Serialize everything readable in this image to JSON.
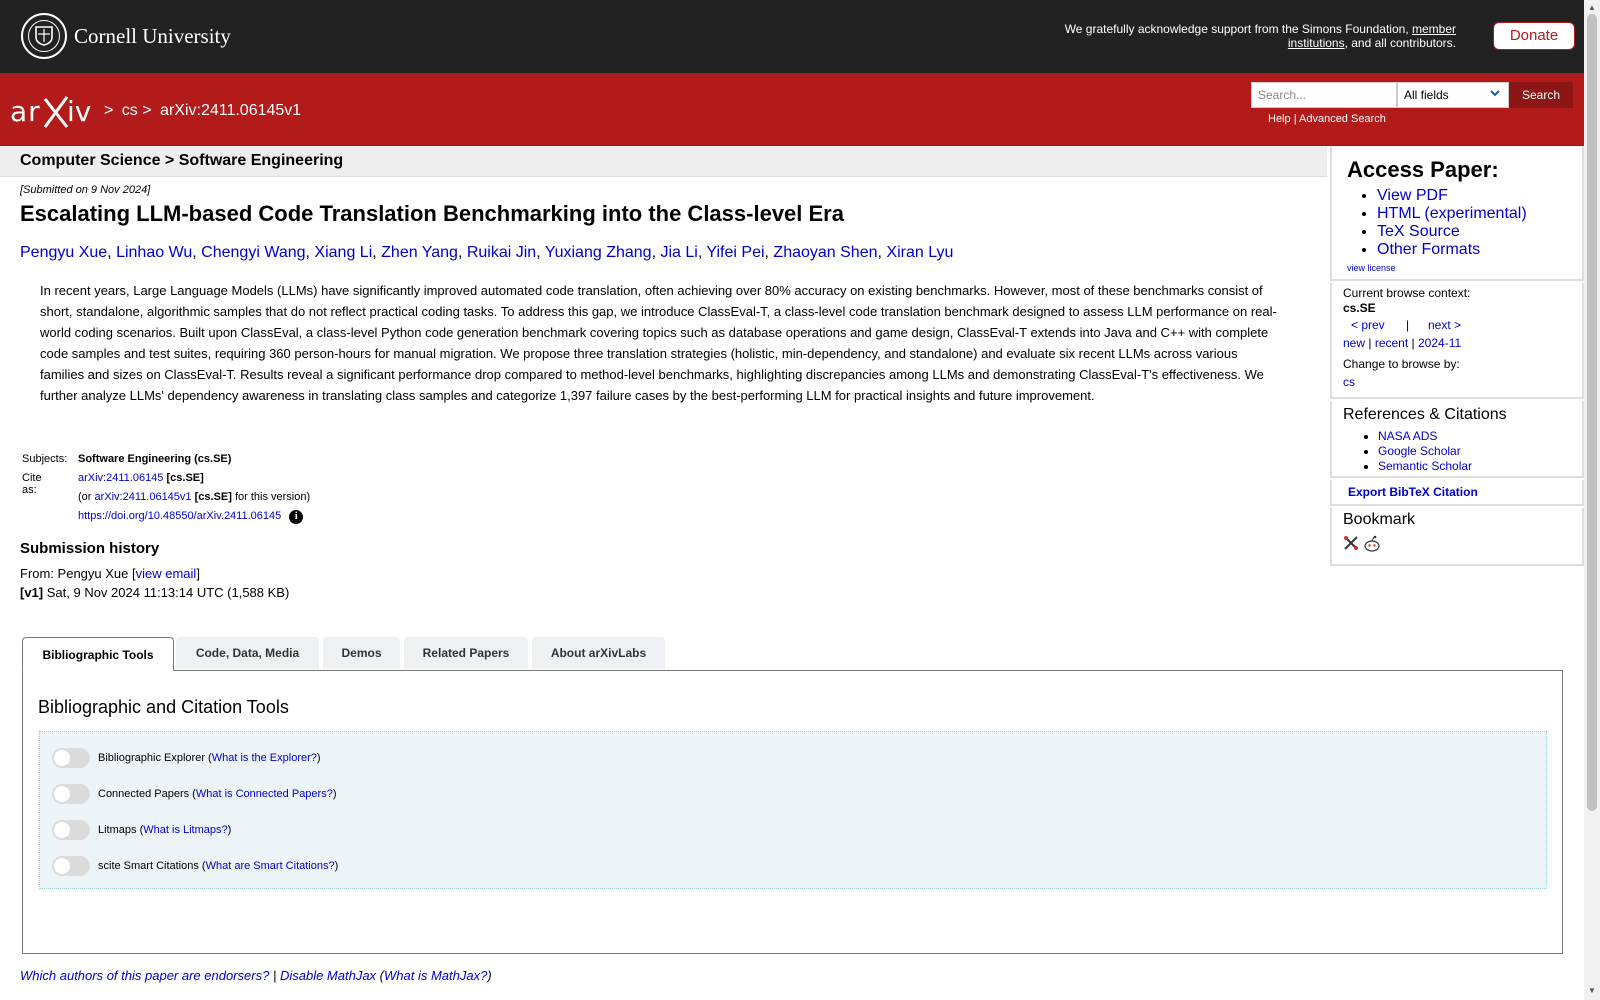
{
  "cornell": {
    "name": "Cornell University",
    "support_prefix": "We gratefully acknowledge support from the Simons Foundation, ",
    "support_link": "member institutions",
    "support_suffix": ", and all contributors.",
    "donate_label": "Donate"
  },
  "header": {
    "logo_text": "arXiv",
    "breadcrumb": [
      ">",
      "cs",
      ">",
      "arXiv:2411.06145v1"
    ],
    "search_placeholder": "Search...",
    "search_field": "All fields",
    "search_button": "Search",
    "help_link": "Help",
    "help_sep": "|",
    "advanced_search": "Advanced Search"
  },
  "subject_heading": "Computer Science > Software Engineering",
  "paper": {
    "submitted": "[Submitted on 9 Nov 2024]",
    "title": "Escalating LLM-based Code Translation Benchmarking into the Class-level Era",
    "authors": [
      "Pengyu Xue",
      "Linhao Wu",
      "Chengyi Wang",
      "Xiang Li",
      "Zhen Yang",
      "Ruikai Jin",
      "Yuxiang Zhang",
      "Jia Li",
      "Yifei Pei",
      "Zhaoyan Shen",
      "Xiran Lyu"
    ],
    "abstract": "In recent years, Large Language Models (LLMs) have significantly improved automated code translation, often achieving over 80% accuracy on existing benchmarks. However, most of these benchmarks consist of short, standalone, algorithmic samples that do not reflect practical coding tasks. To address this gap, we introduce ClassEval-T, a class-level code translation benchmark designed to assess LLM performance on real-world coding scenarios. Built upon ClassEval, a class-level Python code generation benchmark covering topics such as database operations and game design, ClassEval-T extends into Java and C++ with complete code samples and test suites, requiring 360 person-hours for manual migration. We propose three translation strategies (holistic, min-dependency, and standalone) and evaluate six recent LLMs across various families and sizes on ClassEval-T. Results reveal a significant performance drop compared to method-level benchmarks, highlighting discrepancies among LLMs and demonstrating ClassEval-T's effectiveness. We further analyze LLMs' dependency awareness in translating class samples and categorize 1,397 failure cases by the best-performing LLM for practical insights and future improvement."
  },
  "metadata": {
    "subjects_label": "Subjects:",
    "subjects_value": "Software Engineering (cs.SE)",
    "cite_label": "Cite as:",
    "cite_id": "arXiv:2411.06145",
    "cite_tag": "[cs.SE]",
    "version_prefix": "(or ",
    "version_id": "arXiv:2411.06145v1",
    "version_tag": "[cs.SE]",
    "version_suffix": " for this version)",
    "doi": "https://doi.org/10.48550/arXiv.2411.06145"
  },
  "history": {
    "heading": "Submission history",
    "from_prefix": "From: Pengyu Xue [",
    "view_email": "view email",
    "from_suffix": "]",
    "version": "[v1]",
    "version_detail": " Sat, 9 Nov 2024 11:13:14 UTC (1,588 KB)"
  },
  "tabs": [
    "Bibliographic Tools",
    "Code, Data, Media",
    "Demos",
    "Related Papers",
    "About arXivLabs"
  ],
  "tab_panel": {
    "heading": "Bibliographic and Citation Tools",
    "tools": [
      {
        "name": "Bibliographic Explorer",
        "link": "What is the Explorer?",
        "enabled": false
      },
      {
        "name": "Connected Papers",
        "link": "What is Connected Papers?",
        "enabled": false
      },
      {
        "name": "Litmaps",
        "link": "What is Litmaps?",
        "enabled": false
      },
      {
        "name": "scite Smart Citations",
        "link": "What are Smart Citations?",
        "enabled": false
      }
    ]
  },
  "footer": {
    "endorsers": "Which authors of this paper are endorsers?",
    "sep": "|",
    "disable_mathjax": "Disable MathJax",
    "what_mathjax": "What is MathJax?"
  },
  "sidebar": {
    "access_heading": "Access Paper:",
    "access_links": [
      "View PDF",
      "HTML (experimental)",
      "TeX Source",
      "Other Formats"
    ],
    "view_license": "view license",
    "browse_context_label": "Current browse context:",
    "browse_context": "cs.SE",
    "prev": "< prev",
    "nav_sep": "|",
    "next": "next >",
    "new": "new",
    "recent": "recent",
    "month": "2024-11",
    "change_browse": "Change to browse by:",
    "browse_cs": "cs",
    "refs_heading": "References & Citations",
    "refs": [
      "NASA ADS",
      "Google Scholar",
      "Semantic Scholar"
    ],
    "bibtex": "Export BibTeX Citation",
    "bookmark_heading": "Bookmark",
    "bookmark_icons": [
      "bibsonomy-icon",
      "reddit-icon"
    ]
  },
  "colors": {
    "arxiv_red": "#b31b1b",
    "cornell_bar": "#222222",
    "link": "#0000cc"
  }
}
